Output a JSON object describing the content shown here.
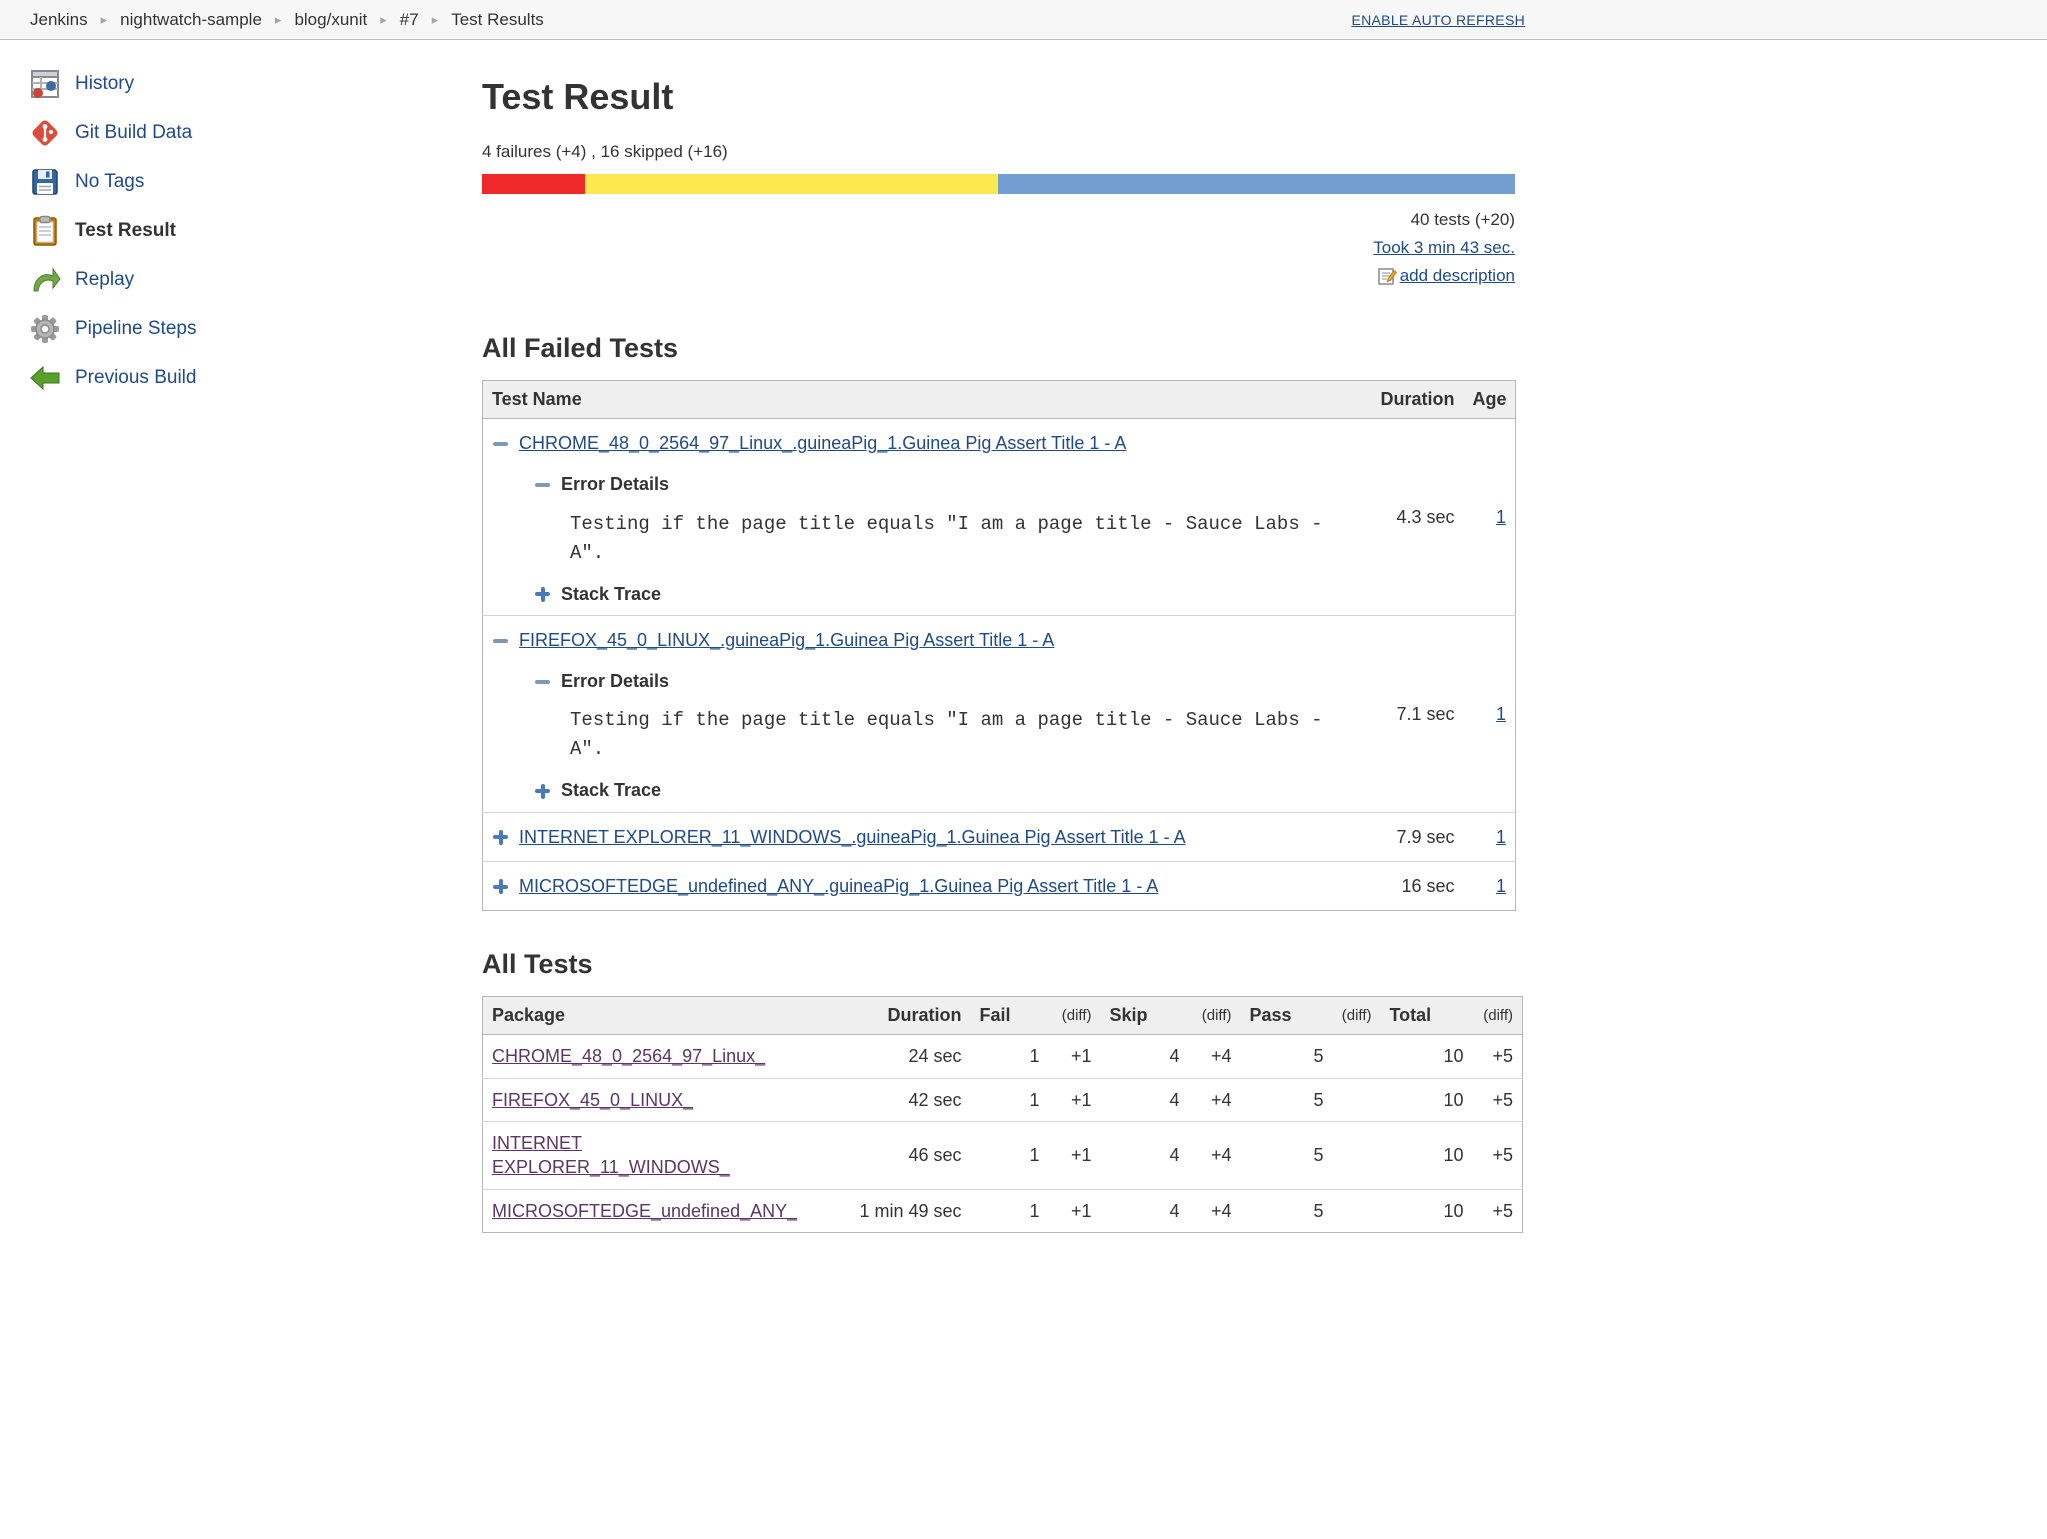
{
  "breadcrumb": {
    "items": [
      "Jenkins",
      "nightwatch-sample",
      "blog/xunit",
      "#7",
      "Test Results"
    ],
    "auto_refresh_label": "ENABLE AUTO REFRESH"
  },
  "sidebar": {
    "items": [
      {
        "label": "History"
      },
      {
        "label": "Git Build Data"
      },
      {
        "label": "No Tags"
      },
      {
        "label": "Test Result"
      },
      {
        "label": "Replay"
      },
      {
        "label": "Pipeline Steps"
      },
      {
        "label": "Previous Build"
      }
    ]
  },
  "main": {
    "title": "Test Result",
    "failure_summary": "4 failures (+4) , 16 skipped (+16)",
    "progress": {
      "fail_percent": 10,
      "skip_percent": 40,
      "pass_percent": 50,
      "fail_color": "#EF2929",
      "skip_color": "#FCE94F",
      "pass_color": "#729FCF"
    },
    "total_label": "40 tests (+20)",
    "took_label": "Took 3 min 43 sec.",
    "add_description_label": "add description",
    "failed_section": {
      "heading": "All Failed Tests",
      "col_test_name": "Test Name",
      "col_duration": "Duration",
      "col_age": "Age",
      "error_details_label": "Error Details",
      "stack_trace_label": "Stack Trace",
      "rows": [
        {
          "name": "CHROME_48_0_2564_97_Linux_.guineaPig_1.Guinea Pig Assert Title 1 - A",
          "expanded": true,
          "error_text": "Testing if the page title equals \"I am a page title - Sauce Labs - A\".",
          "duration": "4.3 sec",
          "age": "1"
        },
        {
          "name": "FIREFOX_45_0_LINUX_.guineaPig_1.Guinea Pig Assert Title 1 - A",
          "expanded": true,
          "error_text": "Testing if the page title equals \"I am a page title - Sauce Labs - A\".",
          "duration": "7.1 sec",
          "age": "1"
        },
        {
          "name": "INTERNET EXPLORER_11_WINDOWS_.guineaPig_1.Guinea Pig Assert Title 1 - A",
          "expanded": false,
          "duration": "7.9 sec",
          "age": "1"
        },
        {
          "name": "MICROSOFTEDGE_undefined_ANY_.guineaPig_1.Guinea Pig Assert Title 1 - A",
          "expanded": false,
          "duration": "16 sec",
          "age": "1"
        }
      ]
    },
    "all_tests_section": {
      "heading": "All Tests",
      "columns": {
        "package": "Package",
        "duration": "Duration",
        "fail": "Fail",
        "diff": "(diff)",
        "skip": "Skip",
        "pass": "Pass",
        "total": "Total"
      },
      "rows": [
        {
          "package": "CHROME_48_0_2564_97_Linux_",
          "duration": "24 sec",
          "fail": "1",
          "fail_diff": "+1",
          "skip": "4",
          "skip_diff": "+4",
          "pass": "5",
          "pass_diff": "",
          "total": "10",
          "total_diff": "+5"
        },
        {
          "package": "FIREFOX_45_0_LINUX_",
          "duration": "42 sec",
          "fail": "1",
          "fail_diff": "+1",
          "skip": "4",
          "skip_diff": "+4",
          "pass": "5",
          "pass_diff": "",
          "total": "10",
          "total_diff": "+5"
        },
        {
          "package": "INTERNET EXPLORER_11_WINDOWS_",
          "duration": "46 sec",
          "fail": "1",
          "fail_diff": "+1",
          "skip": "4",
          "skip_diff": "+4",
          "pass": "5",
          "pass_diff": "",
          "total": "10",
          "total_diff": "+5"
        },
        {
          "package": "MICROSOFTEDGE_undefined_ANY_",
          "duration": "1 min 49 sec",
          "fail": "1",
          "fail_diff": "+1",
          "skip": "4",
          "skip_diff": "+4",
          "pass": "5",
          "pass_diff": "",
          "total": "10",
          "total_diff": "+5"
        }
      ]
    }
  }
}
